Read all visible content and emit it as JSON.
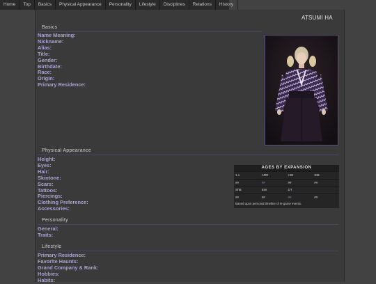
{
  "nav": {
    "items": [
      "Home",
      "Top",
      "Basics",
      "Physical Appearance",
      "Personality",
      "Lifestyle",
      "Disciplines",
      "Relations",
      "History"
    ]
  },
  "page": {
    "title": "ATSUMI HA"
  },
  "sections": {
    "basics": {
      "title": "Basics",
      "fields": [
        "Name Meaning:",
        "Nickname:",
        "Alias:",
        "Title:",
        "Gender:",
        "Birthdate:",
        "Race:",
        "Origin:",
        "Primary Residence:"
      ]
    },
    "physical": {
      "title": "Physical Appearance",
      "fields": [
        "Height:",
        "Eyes:",
        "Hair:",
        "Skintone:",
        "Scars:",
        "Tattoos:",
        "Piercings:",
        "Clothing Preference:",
        "Accessories:"
      ]
    },
    "personality": {
      "title": "Personality",
      "fields": [
        "General:",
        "Traits:"
      ]
    },
    "lifestyle": {
      "title": "Lifestyle",
      "fields": [
        "Primary Residence:",
        "Favorite Haunts:",
        "Grand Company & Rank:",
        "Hobbies:",
        "Habits:"
      ]
    }
  },
  "ages_table": {
    "title": "AGES BY EXPANSION",
    "header1": [
      "1.x",
      "ARR",
      "HW",
      "StB"
    ],
    "values1": [
      "##",
      "##",
      "##",
      "##"
    ],
    "header2": [
      "ShB",
      "EW",
      "DT",
      ""
    ],
    "values2": [
      "##",
      "##",
      "##",
      "##"
    ],
    "note": "Based upon personal timeline of in-game events."
  },
  "colors": {
    "background": "#424242",
    "nav_background": "#2b2b2b",
    "label": "#a8a2cf",
    "accent": "#8a84c0"
  }
}
